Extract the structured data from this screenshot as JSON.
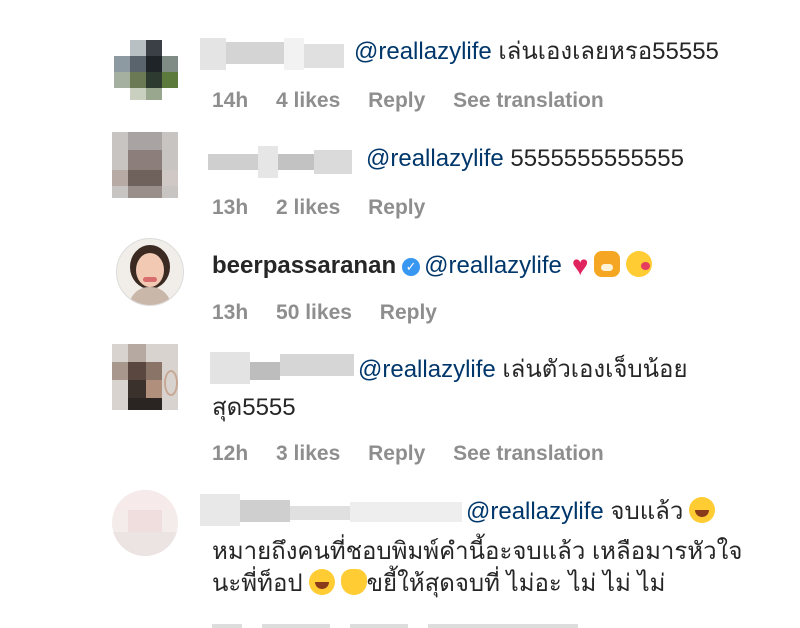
{
  "comments": [
    {
      "mention": "@reallazylife",
      "text": " เล่นเองเลยหรอ55555",
      "time": "14h",
      "likes": "4 likes",
      "reply": "Reply",
      "translate": "See translation"
    },
    {
      "mention": "@reallazylife",
      "text": " 5555555555555",
      "time": "13h",
      "likes": "2 likes",
      "reply": "Reply"
    },
    {
      "username": "beerpassaranan",
      "verified_icon": "verified-badge-icon",
      "mention": "@reallazylife",
      "emojis": [
        "heart-icon",
        "tiger-emoji-icon",
        "kiss-emoji-icon"
      ],
      "time": "13h",
      "likes": "50 likes",
      "reply": "Reply"
    },
    {
      "mention": "@reallazylife",
      "text": " เล่นตัวเองเจ็บน้อย",
      "text_line2": "สุด5555",
      "time": "12h",
      "likes": "3 likes",
      "reply": "Reply",
      "translate": "See translation"
    },
    {
      "mention": "@reallazylife",
      "text": " จบแล้ว",
      "text_line2": "หมายถึงคนที่ชอบพิมพ์คำนี้อะจบแล้ว เหลือมารหัวใจ",
      "text_line3a": "นะพี่ท็อป",
      "text_line3b": "ขยี้ให้สุดจบที่ ไม่อะ ไม่ ไม่ ไม่",
      "emojis": [
        "laugh-cry-emoji-icon",
        "clap-emoji-icon"
      ]
    }
  ],
  "colors": {
    "mention": "#00376b",
    "meta": "#8e8e8e",
    "verified": "#3897f0",
    "heart": "#e0245e"
  }
}
